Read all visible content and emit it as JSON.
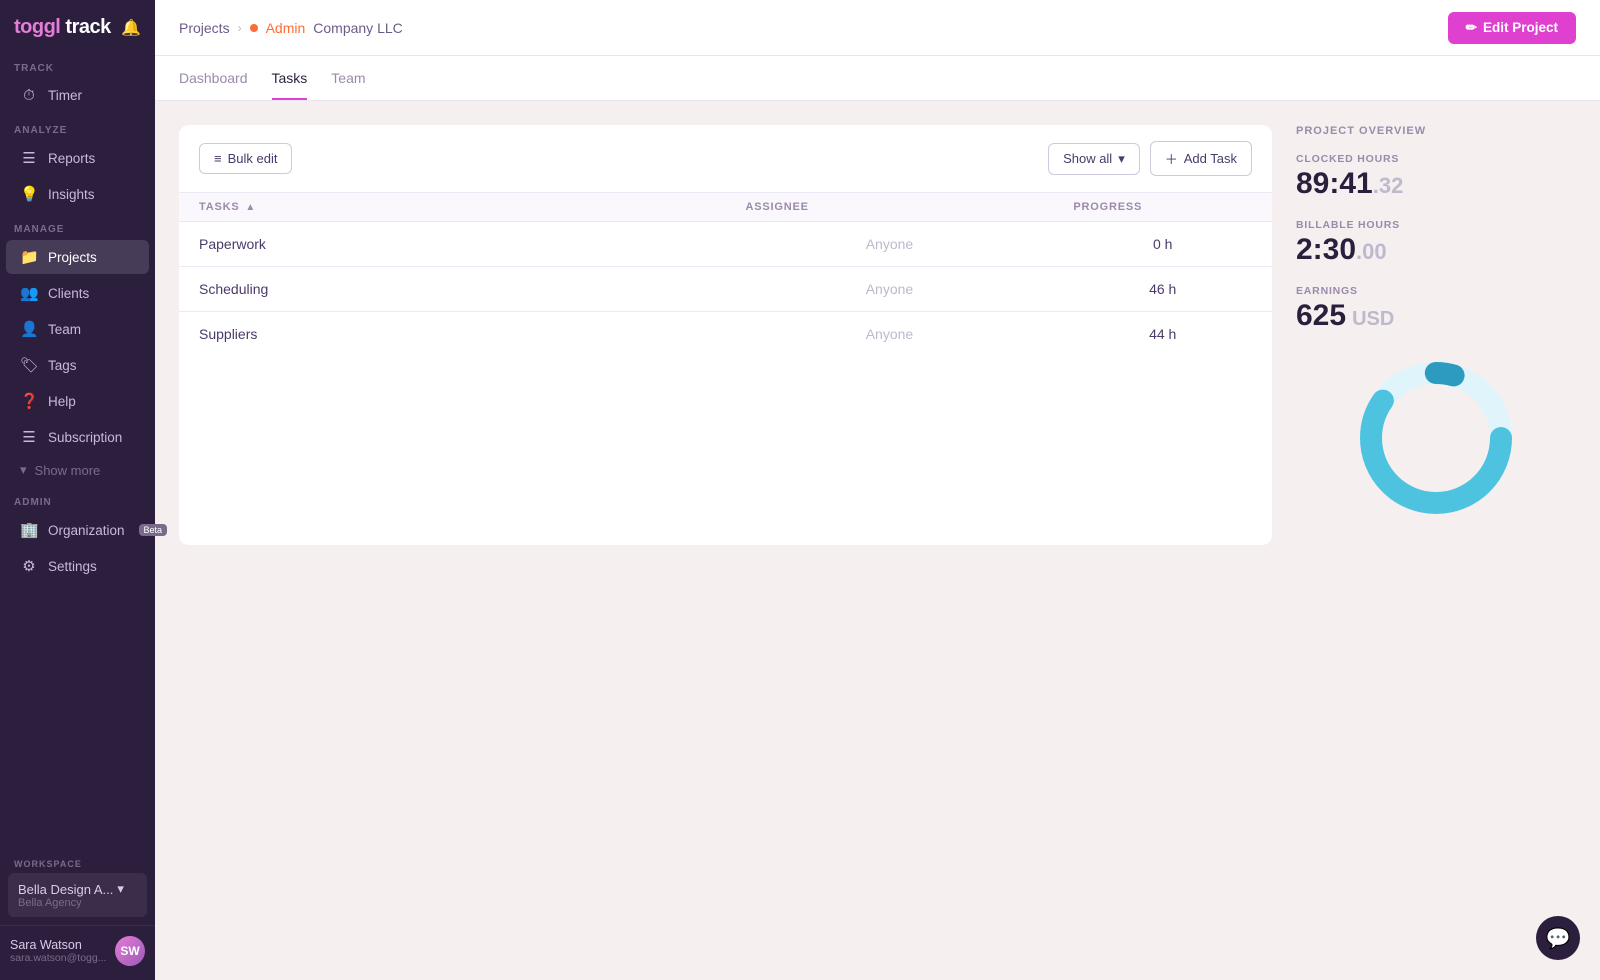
{
  "app": {
    "logo": "toggl track",
    "logo_color": "toggl",
    "logo_track": "track"
  },
  "sidebar": {
    "track_label": "TRACK",
    "analyze_label": "ANALYZE",
    "manage_label": "MANAGE",
    "admin_label": "ADMIN",
    "items": {
      "timer": "Timer",
      "reports": "Reports",
      "insights": "Insights",
      "projects": "Projects",
      "clients": "Clients",
      "team": "Team",
      "tags": "Tags",
      "help": "Help",
      "subscription": "Subscription",
      "show_more": "Show more",
      "organization": "Organization",
      "organization_badge": "Beta",
      "settings": "Settings"
    }
  },
  "workspace": {
    "label": "WORKSPACE",
    "name": "Bella Design A...",
    "sub": "Bella Agency",
    "chevron": "▾"
  },
  "user": {
    "name": "Sara Watson",
    "email": "sara.watson@togg...",
    "initials": "SW"
  },
  "header": {
    "breadcrumb": {
      "projects": "Projects",
      "admin": "Admin",
      "company": "Company LLC"
    },
    "edit_button": "Edit Project"
  },
  "tabs": {
    "dashboard": "Dashboard",
    "tasks": "Tasks",
    "team": "Team"
  },
  "tasks_panel": {
    "bulk_edit": "Bulk edit",
    "show_all": "Show all",
    "add_task": "Add Task",
    "columns": {
      "tasks": "TASKS",
      "assignee": "ASSIGNEE",
      "progress": "PROGRESS"
    },
    "rows": [
      {
        "task": "Paperwork",
        "assignee": "Anyone",
        "progress": "0 h"
      },
      {
        "task": "Scheduling",
        "assignee": "Anyone",
        "progress": "46 h"
      },
      {
        "task": "Suppliers",
        "assignee": "Anyone",
        "progress": "44 h"
      }
    ]
  },
  "project_overview": {
    "title": "PROJECT OVERVIEW",
    "clocked_hours_label": "CLOCKED HOURS",
    "clocked_hours_main": "89:41",
    "clocked_hours_decimal": ".32",
    "billable_hours_label": "BILLABLE HOURS",
    "billable_hours_main": "2:30",
    "billable_hours_decimal": ".00",
    "earnings_label": "EARNINGS",
    "earnings_main": "625",
    "earnings_unit": "USD",
    "donut": {
      "total": 100,
      "filled": 75,
      "color_filled": "#4ec3e0",
      "color_empty": "#e8f7fc",
      "accent": "#2d9bbf"
    }
  }
}
